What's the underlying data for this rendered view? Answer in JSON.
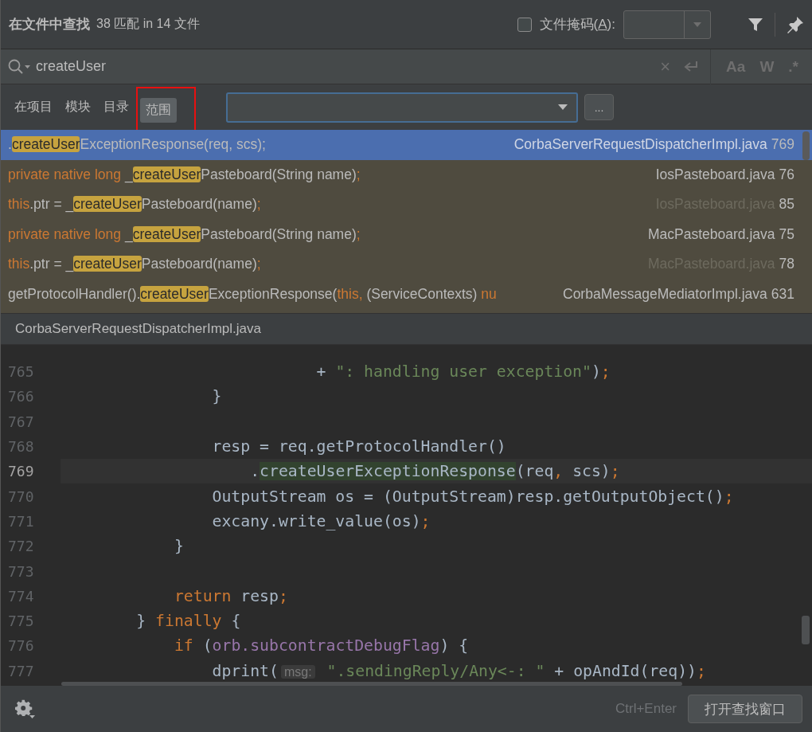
{
  "header": {
    "title": "在文件中查找",
    "summary": "38 匹配 in 14 文件",
    "file_mask": {
      "checked": false,
      "label_before": "文件掩码(",
      "mnemonic": "A",
      "label_after": "):"
    }
  },
  "search": {
    "value": "createUser",
    "clear": "×",
    "toggles": [
      "Aa",
      "W",
      ".*"
    ]
  },
  "scopes": [
    {
      "label": "在项目",
      "selected": false,
      "annotated": false
    },
    {
      "label": "模块",
      "selected": false,
      "annotated": false
    },
    {
      "label": "目录",
      "selected": false,
      "annotated": false
    },
    {
      "label": "范围",
      "selected": true,
      "annotated": true
    }
  ],
  "scope_more": "...",
  "results": [
    {
      "selected": true,
      "file": "CorbaServerRequestDispatcherImpl.java",
      "line": "769",
      "dimmed": false,
      "parts": [
        {
          "kind": "plain",
          "text": "."
        },
        {
          "kind": "match",
          "text": "createUser"
        },
        {
          "kind": "plain",
          "text": "ExceptionResponse(req, scs);"
        }
      ]
    },
    {
      "selected": false,
      "file": "IosPasteboard.java",
      "line": "76",
      "dimmed": false,
      "parts": [
        {
          "kind": "keyword",
          "text": "private native long "
        },
        {
          "kind": "plain",
          "text": "_"
        },
        {
          "kind": "match",
          "text": "createUser"
        },
        {
          "kind": "plain",
          "text": "Pasteboard(String name)"
        },
        {
          "kind": "keyword",
          "text": ";"
        }
      ]
    },
    {
      "selected": false,
      "file": "IosPasteboard.java",
      "line": "85",
      "dimmed": true,
      "parts": [
        {
          "kind": "keyword",
          "text": "this"
        },
        {
          "kind": "plain",
          "text": ".ptr = _"
        },
        {
          "kind": "match",
          "text": "createUser"
        },
        {
          "kind": "plain",
          "text": "Pasteboard(name)"
        },
        {
          "kind": "keyword",
          "text": ";"
        }
      ]
    },
    {
      "selected": false,
      "file": "MacPasteboard.java",
      "line": "75",
      "dimmed": false,
      "parts": [
        {
          "kind": "keyword",
          "text": "private native long "
        },
        {
          "kind": "plain",
          "text": "_"
        },
        {
          "kind": "match",
          "text": "createUser"
        },
        {
          "kind": "plain",
          "text": "Pasteboard(String name)"
        },
        {
          "kind": "keyword",
          "text": ";"
        }
      ]
    },
    {
      "selected": false,
      "file": "MacPasteboard.java",
      "line": "78",
      "dimmed": true,
      "parts": [
        {
          "kind": "keyword",
          "text": "this"
        },
        {
          "kind": "plain",
          "text": ".ptr = _"
        },
        {
          "kind": "match",
          "text": "createUser"
        },
        {
          "kind": "plain",
          "text": "Pasteboard(name)"
        },
        {
          "kind": "keyword",
          "text": ";"
        }
      ]
    },
    {
      "selected": false,
      "file": "CorbaMessageMediatorImpl.java",
      "line": "631",
      "dimmed": false,
      "parts": [
        {
          "kind": "plain",
          "text": "getProtocolHandler()."
        },
        {
          "kind": "match",
          "text": "createUser"
        },
        {
          "kind": "plain",
          "text": "ExceptionResponse("
        },
        {
          "kind": "keyword",
          "text": "this,"
        },
        {
          "kind": "plain",
          "text": " (ServiceContexts) "
        },
        {
          "kind": "keyword",
          "text": "nu"
        }
      ]
    }
  ],
  "preview": {
    "file": "CorbaServerRequestDispatcherImpl.java",
    "lines": [
      {
        "number": "765",
        "current": false,
        "parts": [
          {
            "kind": "plain",
            "text": "                           + "
          },
          {
            "kind": "string",
            "text": "\": handling user exception\""
          },
          {
            "kind": "plain",
            "text": ")"
          },
          {
            "kind": "keyword",
            "text": ";"
          }
        ]
      },
      {
        "number": "766",
        "current": false,
        "parts": [
          {
            "kind": "plain",
            "text": "                }"
          }
        ]
      },
      {
        "number": "767",
        "current": false
      },
      {
        "number": "768",
        "current": false,
        "parts": [
          {
            "kind": "plain",
            "text": "                resp = req.getProtocolHandler()"
          }
        ]
      },
      {
        "number": "769",
        "current": true,
        "parts": [
          {
            "kind": "plain",
            "text": "                    ."
          },
          {
            "kind": "match",
            "text": "createUserExceptionResponse"
          },
          {
            "kind": "plain",
            "text": "(req"
          },
          {
            "kind": "keyword",
            "text": ","
          },
          {
            "kind": "plain",
            "text": " scs)"
          },
          {
            "kind": "keyword",
            "text": ";"
          }
        ]
      },
      {
        "number": "770",
        "current": false,
        "parts": [
          {
            "kind": "plain",
            "text": "                OutputStream os = (OutputStream)resp.getOutputObject()"
          },
          {
            "kind": "keyword",
            "text": ";"
          }
        ]
      },
      {
        "number": "771",
        "current": false,
        "parts": [
          {
            "kind": "plain",
            "text": "                excany.write_value(os)"
          },
          {
            "kind": "keyword",
            "text": ";"
          }
        ]
      },
      {
        "number": "772",
        "current": false,
        "parts": [
          {
            "kind": "plain",
            "text": "            }"
          }
        ]
      },
      {
        "number": "773",
        "current": false
      },
      {
        "number": "774",
        "current": false,
        "parts": [
          {
            "kind": "keyword",
            "text": "            return"
          },
          {
            "kind": "plain",
            "text": " resp"
          },
          {
            "kind": "keyword",
            "text": ";"
          }
        ]
      },
      {
        "number": "775",
        "current": false,
        "parts": [
          {
            "kind": "plain",
            "text": "        } "
          },
          {
            "kind": "keyword",
            "text": "finally"
          },
          {
            "kind": "plain",
            "text": " {"
          }
        ]
      },
      {
        "number": "776",
        "current": false,
        "parts": [
          {
            "kind": "keyword",
            "text": "            if"
          },
          {
            "kind": "plain",
            "text": " ("
          },
          {
            "kind": "field",
            "text": "orb.subcontractDebugFlag"
          },
          {
            "kind": "plain",
            "text": ") {"
          }
        ]
      },
      {
        "number": "777",
        "current": false,
        "parts": [
          {
            "kind": "plain",
            "text": "                dprint("
          },
          {
            "kind": "hint",
            "text": "msg:"
          },
          {
            "kind": "string",
            "text": " \".sendingReply/Any<-: \""
          },
          {
            "kind": "plain",
            "text": " + opAndId(req))"
          },
          {
            "kind": "keyword",
            "text": ";"
          }
        ]
      }
    ]
  },
  "footer": {
    "shortcut": "Ctrl+Enter",
    "button": "打开查找窗口"
  }
}
